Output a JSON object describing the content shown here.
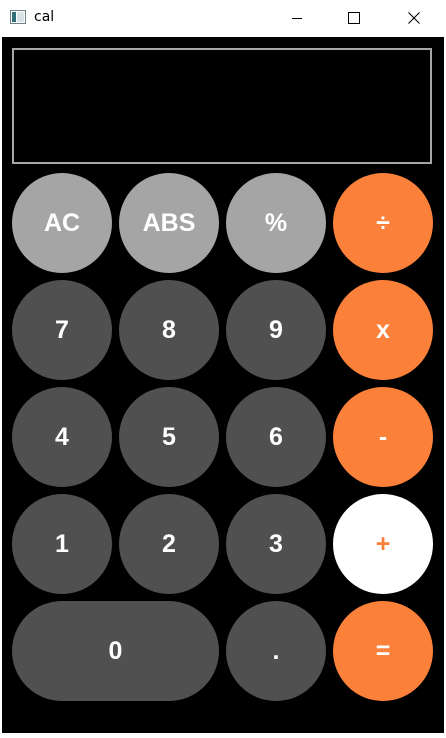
{
  "window": {
    "title": "cal",
    "app_icon": "window-app-icon",
    "controls": {
      "minimize_icon": "minimize-icon",
      "maximize_icon": "maximize-icon",
      "close_icon": "close-icon"
    }
  },
  "display": {
    "value": ""
  },
  "keys": {
    "ac": "AC",
    "abs": "ABS",
    "percent": "%",
    "divide": "÷",
    "seven": "7",
    "eight": "8",
    "nine": "9",
    "multiply": "x",
    "four": "4",
    "five": "5",
    "six": "6",
    "minus": "-",
    "one": "1",
    "two": "2",
    "three": "3",
    "plus": "+",
    "zero": "0",
    "dot": ".",
    "equals": "="
  },
  "colors": {
    "accent": "#fb813a",
    "function_key": "#a5a5a5",
    "digit_key": "#505050",
    "selected_operator": "#ffffff",
    "background": "#000000"
  }
}
